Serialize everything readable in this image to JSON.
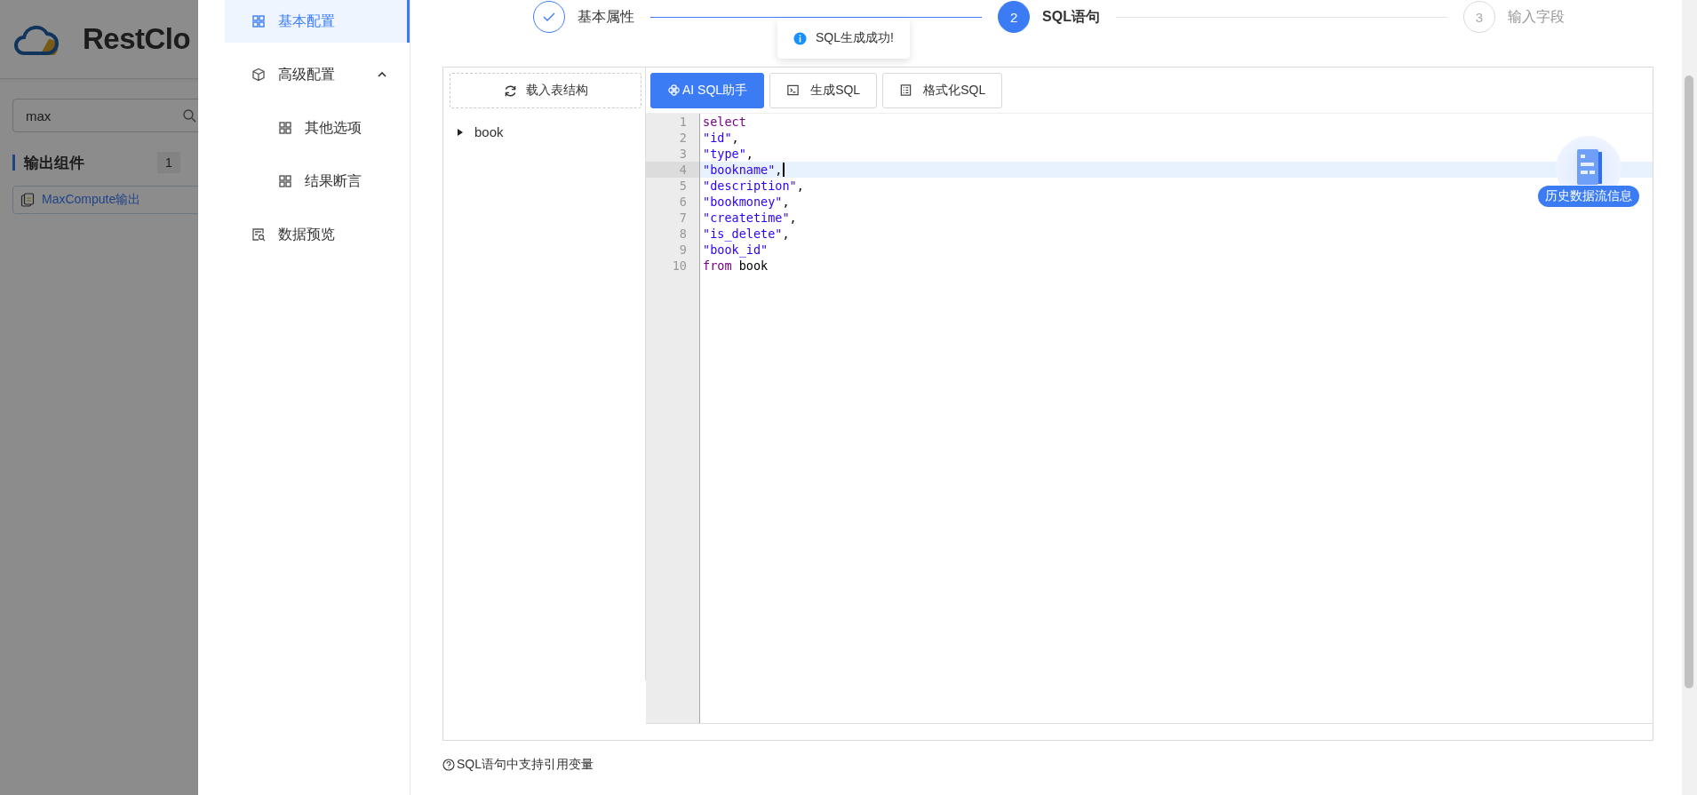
{
  "background_app": {
    "logo_text": "RestClo",
    "search": {
      "value": "max"
    },
    "group": {
      "label": "输出组件",
      "count": "1"
    },
    "items": [
      {
        "label": "MaxCompute输出"
      }
    ]
  },
  "nav": [
    {
      "label": "基本配置",
      "selected": true
    },
    {
      "label": "高级配置",
      "selected": false,
      "expanded": true,
      "children": [
        {
          "label": "其他选项",
          "selected": false
        },
        {
          "label": "结果断言",
          "selected": false
        }
      ]
    },
    {
      "label": "数据预览",
      "selected": false
    }
  ],
  "steps": [
    {
      "label": "基本属性",
      "completed": true,
      "selected": false
    },
    {
      "number": "2",
      "label": "SQL语句",
      "completed": false,
      "selected": true
    },
    {
      "number": "3",
      "label": "输入字段",
      "completed": false,
      "selected": false
    }
  ],
  "toast": {
    "message": "SQL生成成功!"
  },
  "load_button": {
    "label": "载入表结构"
  },
  "tree": [
    {
      "label": "book",
      "expanded": false
    }
  ],
  "toolbar": [
    {
      "label": "AI SQL助手",
      "kind": "assistant"
    },
    {
      "label": "生成SQL",
      "kind": "generate"
    },
    {
      "label": "格式化SQL",
      "kind": "format"
    }
  ],
  "editor": {
    "lines": [
      {
        "number": "1",
        "current": false,
        "tokens": [
          {
            "text": "select",
            "kind": "keyword"
          }
        ]
      },
      {
        "number": "2",
        "current": false,
        "tokens": [
          {
            "text": "\"id\"",
            "kind": "string"
          },
          {
            "text": ",",
            "kind": "plain"
          }
        ]
      },
      {
        "number": "3",
        "current": false,
        "tokens": [
          {
            "text": "\"type\"",
            "kind": "string"
          },
          {
            "text": ",",
            "kind": "plain"
          }
        ]
      },
      {
        "number": "4",
        "current": true,
        "tokens": [
          {
            "text": "\"bookname\"",
            "kind": "string"
          },
          {
            "text": ",",
            "kind": "plain"
          }
        ]
      },
      {
        "number": "5",
        "current": false,
        "tokens": [
          {
            "text": "\"description\"",
            "kind": "string"
          },
          {
            "text": ",",
            "kind": "plain"
          }
        ]
      },
      {
        "number": "6",
        "current": false,
        "tokens": [
          {
            "text": "\"bookmoney\"",
            "kind": "string"
          },
          {
            "text": ",",
            "kind": "plain"
          }
        ]
      },
      {
        "number": "7",
        "current": false,
        "tokens": [
          {
            "text": "\"createtime\"",
            "kind": "string"
          },
          {
            "text": ",",
            "kind": "plain"
          }
        ]
      },
      {
        "number": "8",
        "current": false,
        "tokens": [
          {
            "text": "\"is_delete\"",
            "kind": "string"
          },
          {
            "text": ",",
            "kind": "plain"
          }
        ]
      },
      {
        "number": "9",
        "current": false,
        "tokens": [
          {
            "text": "\"book_id\"",
            "kind": "string"
          }
        ]
      },
      {
        "number": "10",
        "current": false,
        "tokens": [
          {
            "text": "from",
            "kind": "keyword"
          },
          {
            "text": " book",
            "kind": "plain"
          }
        ]
      }
    ]
  },
  "float_button": {
    "label": "历史数据流信息"
  },
  "hint": "SQL语句中支持引用变量"
}
